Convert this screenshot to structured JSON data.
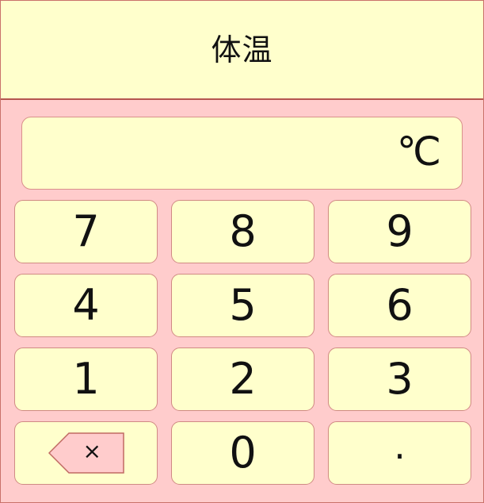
{
  "header": {
    "title": "体温"
  },
  "display": {
    "value": "",
    "unit": "℃"
  },
  "keypad": {
    "rows": [
      [
        "7",
        "8",
        "9"
      ],
      [
        "4",
        "5",
        "6"
      ],
      [
        "1",
        "2",
        "3"
      ],
      [
        "backspace",
        "0",
        "."
      ]
    ],
    "backspace_icon": "backspace-icon",
    "backspace_symbol": "×"
  },
  "colors": {
    "background": "#ffcccc",
    "panel": "#ffffcc",
    "border": "#b5564f"
  }
}
